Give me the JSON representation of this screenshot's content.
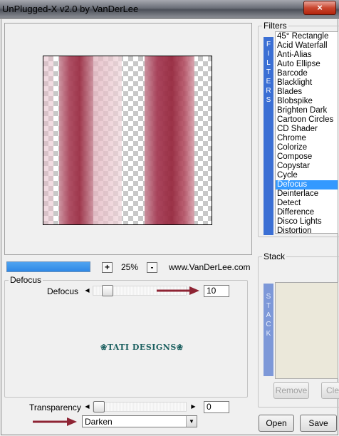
{
  "window": {
    "title": "UnPlugged-X v2.0 by VanDerLee",
    "close_glyph": "×"
  },
  "preview": {
    "zoom_minus": "-",
    "zoom_plus": "+",
    "zoom_value": "25%",
    "url_text": "www.VanDerLee.com",
    "progress": 1.0
  },
  "filters": {
    "label": "Filters",
    "tab_letters": [
      "F",
      "I",
      "L",
      "T",
      "E",
      "R",
      "S"
    ],
    "items": [
      "45° Rectangle",
      "Acid Waterfall",
      "Anti-Alias",
      "Auto Ellipse",
      "Barcode",
      "Blacklight",
      "Blades",
      "Blobspike",
      "Brighten Dark",
      "Cartoon Circles",
      "CD Shader",
      "Chrome",
      "Colorize",
      "Compose",
      "Copystar",
      "Cycle",
      "Defocus",
      "Deinterlace",
      "Detect",
      "Difference",
      "Disco Lights",
      "Distortion"
    ],
    "selected": "Defocus"
  },
  "stack": {
    "label": "Stack",
    "tab_letters": [
      "S",
      "T",
      "A",
      "C",
      "K"
    ],
    "remove_label": "Remove",
    "clear_label": "Clea"
  },
  "params": {
    "group_label": "Defocus",
    "defocus_label": "Defocus",
    "defocus_value": "10",
    "transparency_label": "Transparency",
    "transparency_value": "0",
    "blend_mode": "Darken"
  },
  "watermark": {
    "text": "❀TATI DESIGNS❀"
  },
  "buttons": {
    "open_label": "Open",
    "save_label": "Save"
  },
  "colors": {
    "selection": "#3399ff",
    "band_dark": "#9b2f45",
    "band_light": "#c98a98",
    "arrow": "#8e2434",
    "logo": "#1c6060"
  }
}
